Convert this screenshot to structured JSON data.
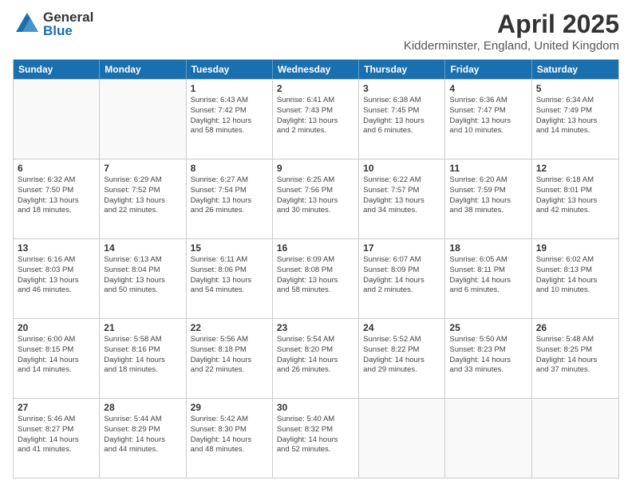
{
  "header": {
    "logo_general": "General",
    "logo_blue": "Blue",
    "month": "April 2025",
    "location": "Kidderminster, England, United Kingdom"
  },
  "days_of_week": [
    "Sunday",
    "Monday",
    "Tuesday",
    "Wednesday",
    "Thursday",
    "Friday",
    "Saturday"
  ],
  "weeks": [
    [
      {
        "day": "",
        "empty": true
      },
      {
        "day": "",
        "empty": true
      },
      {
        "day": "1",
        "line1": "Sunrise: 6:43 AM",
        "line2": "Sunset: 7:42 PM",
        "line3": "Daylight: 12 hours",
        "line4": "and 58 minutes."
      },
      {
        "day": "2",
        "line1": "Sunrise: 6:41 AM",
        "line2": "Sunset: 7:43 PM",
        "line3": "Daylight: 13 hours",
        "line4": "and 2 minutes."
      },
      {
        "day": "3",
        "line1": "Sunrise: 6:38 AM",
        "line2": "Sunset: 7:45 PM",
        "line3": "Daylight: 13 hours",
        "line4": "and 6 minutes."
      },
      {
        "day": "4",
        "line1": "Sunrise: 6:36 AM",
        "line2": "Sunset: 7:47 PM",
        "line3": "Daylight: 13 hours",
        "line4": "and 10 minutes."
      },
      {
        "day": "5",
        "line1": "Sunrise: 6:34 AM",
        "line2": "Sunset: 7:49 PM",
        "line3": "Daylight: 13 hours",
        "line4": "and 14 minutes."
      }
    ],
    [
      {
        "day": "6",
        "line1": "Sunrise: 6:32 AM",
        "line2": "Sunset: 7:50 PM",
        "line3": "Daylight: 13 hours",
        "line4": "and 18 minutes."
      },
      {
        "day": "7",
        "line1": "Sunrise: 6:29 AM",
        "line2": "Sunset: 7:52 PM",
        "line3": "Daylight: 13 hours",
        "line4": "and 22 minutes."
      },
      {
        "day": "8",
        "line1": "Sunrise: 6:27 AM",
        "line2": "Sunset: 7:54 PM",
        "line3": "Daylight: 13 hours",
        "line4": "and 26 minutes."
      },
      {
        "day": "9",
        "line1": "Sunrise: 6:25 AM",
        "line2": "Sunset: 7:56 PM",
        "line3": "Daylight: 13 hours",
        "line4": "and 30 minutes."
      },
      {
        "day": "10",
        "line1": "Sunrise: 6:22 AM",
        "line2": "Sunset: 7:57 PM",
        "line3": "Daylight: 13 hours",
        "line4": "and 34 minutes."
      },
      {
        "day": "11",
        "line1": "Sunrise: 6:20 AM",
        "line2": "Sunset: 7:59 PM",
        "line3": "Daylight: 13 hours",
        "line4": "and 38 minutes."
      },
      {
        "day": "12",
        "line1": "Sunrise: 6:18 AM",
        "line2": "Sunset: 8:01 PM",
        "line3": "Daylight: 13 hours",
        "line4": "and 42 minutes."
      }
    ],
    [
      {
        "day": "13",
        "line1": "Sunrise: 6:16 AM",
        "line2": "Sunset: 8:03 PM",
        "line3": "Daylight: 13 hours",
        "line4": "and 46 minutes."
      },
      {
        "day": "14",
        "line1": "Sunrise: 6:13 AM",
        "line2": "Sunset: 8:04 PM",
        "line3": "Daylight: 13 hours",
        "line4": "and 50 minutes."
      },
      {
        "day": "15",
        "line1": "Sunrise: 6:11 AM",
        "line2": "Sunset: 8:06 PM",
        "line3": "Daylight: 13 hours",
        "line4": "and 54 minutes."
      },
      {
        "day": "16",
        "line1": "Sunrise: 6:09 AM",
        "line2": "Sunset: 8:08 PM",
        "line3": "Daylight: 13 hours",
        "line4": "and 58 minutes."
      },
      {
        "day": "17",
        "line1": "Sunrise: 6:07 AM",
        "line2": "Sunset: 8:09 PM",
        "line3": "Daylight: 14 hours",
        "line4": "and 2 minutes."
      },
      {
        "day": "18",
        "line1": "Sunrise: 6:05 AM",
        "line2": "Sunset: 8:11 PM",
        "line3": "Daylight: 14 hours",
        "line4": "and 6 minutes."
      },
      {
        "day": "19",
        "line1": "Sunrise: 6:02 AM",
        "line2": "Sunset: 8:13 PM",
        "line3": "Daylight: 14 hours",
        "line4": "and 10 minutes."
      }
    ],
    [
      {
        "day": "20",
        "line1": "Sunrise: 6:00 AM",
        "line2": "Sunset: 8:15 PM",
        "line3": "Daylight: 14 hours",
        "line4": "and 14 minutes."
      },
      {
        "day": "21",
        "line1": "Sunrise: 5:58 AM",
        "line2": "Sunset: 8:16 PM",
        "line3": "Daylight: 14 hours",
        "line4": "and 18 minutes."
      },
      {
        "day": "22",
        "line1": "Sunrise: 5:56 AM",
        "line2": "Sunset: 8:18 PM",
        "line3": "Daylight: 14 hours",
        "line4": "and 22 minutes."
      },
      {
        "day": "23",
        "line1": "Sunrise: 5:54 AM",
        "line2": "Sunset: 8:20 PM",
        "line3": "Daylight: 14 hours",
        "line4": "and 26 minutes."
      },
      {
        "day": "24",
        "line1": "Sunrise: 5:52 AM",
        "line2": "Sunset: 8:22 PM",
        "line3": "Daylight: 14 hours",
        "line4": "and 29 minutes."
      },
      {
        "day": "25",
        "line1": "Sunrise: 5:50 AM",
        "line2": "Sunset: 8:23 PM",
        "line3": "Daylight: 14 hours",
        "line4": "and 33 minutes."
      },
      {
        "day": "26",
        "line1": "Sunrise: 5:48 AM",
        "line2": "Sunset: 8:25 PM",
        "line3": "Daylight: 14 hours",
        "line4": "and 37 minutes."
      }
    ],
    [
      {
        "day": "27",
        "line1": "Sunrise: 5:46 AM",
        "line2": "Sunset: 8:27 PM",
        "line3": "Daylight: 14 hours",
        "line4": "and 41 minutes."
      },
      {
        "day": "28",
        "line1": "Sunrise: 5:44 AM",
        "line2": "Sunset: 8:29 PM",
        "line3": "Daylight: 14 hours",
        "line4": "and 44 minutes."
      },
      {
        "day": "29",
        "line1": "Sunrise: 5:42 AM",
        "line2": "Sunset: 8:30 PM",
        "line3": "Daylight: 14 hours",
        "line4": "and 48 minutes."
      },
      {
        "day": "30",
        "line1": "Sunrise: 5:40 AM",
        "line2": "Sunset: 8:32 PM",
        "line3": "Daylight: 14 hours",
        "line4": "and 52 minutes."
      },
      {
        "day": "",
        "empty": true
      },
      {
        "day": "",
        "empty": true
      },
      {
        "day": "",
        "empty": true
      }
    ]
  ]
}
